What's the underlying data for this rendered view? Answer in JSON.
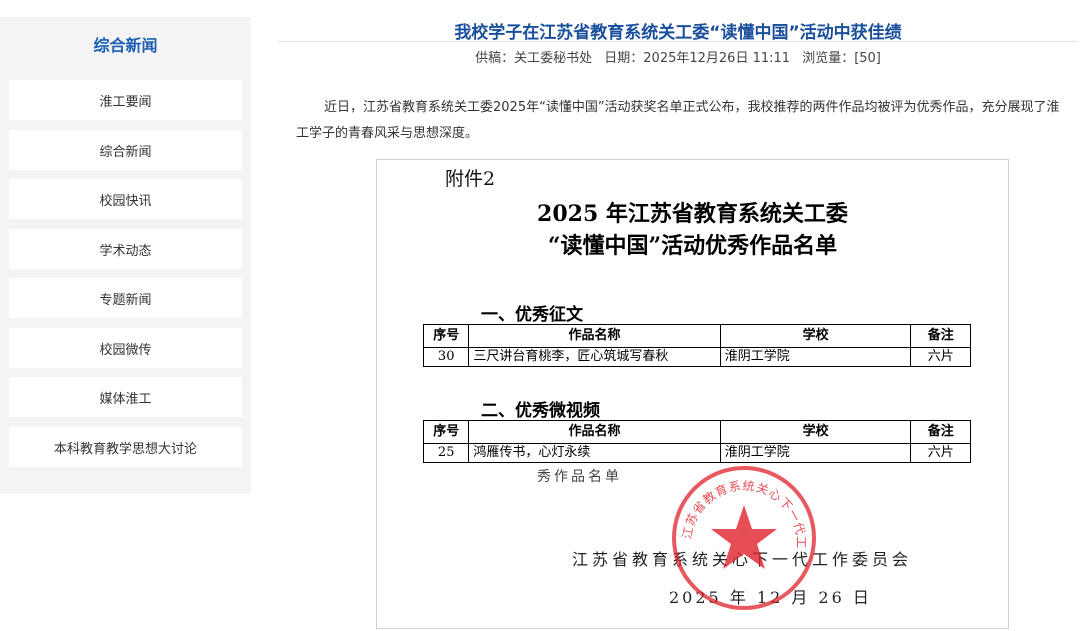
{
  "sidebar": {
    "title": "综合新闻",
    "items": [
      {
        "label": "淮工要闻"
      },
      {
        "label": "综合新闻"
      },
      {
        "label": "校园快讯"
      },
      {
        "label": "学术动态"
      },
      {
        "label": "专题新闻"
      },
      {
        "label": "校园微传"
      },
      {
        "label": "媒体淮工"
      },
      {
        "label": "本科教育教学思想大讨论"
      }
    ]
  },
  "article": {
    "title": "我校学子在江苏省教育系统关工委“读懂中国”活动中获佳绩",
    "meta": {
      "source": "供稿：关工委秘书处",
      "date": "日期：2025年12月26日 11:11",
      "views": "浏览量：[50]"
    },
    "body": "近日，江苏省教育系统关工委2025年“读懂中国”活动获奖名单正式公布，我校推荐的两件作品均被评为优秀作品，充分展现了淮工学子的青春风采与思想深度。"
  },
  "document": {
    "attachment": "附件2",
    "heading_line1": "2025 年江苏省教育系统关工委",
    "heading_line2": "“读懂中国”活动优秀作品名单",
    "section1": "一、优秀征文",
    "section2": "二、优秀微视频",
    "headers": {
      "no": "序号",
      "work": "作品名称",
      "school": "学校",
      "note": "备注"
    },
    "essay_rows": [
      {
        "no": "30",
        "work": "三尺讲台育桃李，匠心筑城写春秋",
        "school": "淮阴工学院",
        "note": "六片"
      }
    ],
    "video_rows": [
      {
        "no": "25",
        "work": "鸿雁传书，心灯永续",
        "school": "淮阴工学院",
        "note": "六片"
      }
    ],
    "handnote": "秀作品名单",
    "signature": "江苏省教育系统关心下一代工作委员会",
    "date": "2025 年 12 月 26 日",
    "seal_text": "江苏省教育系统关心下一代工作委员会",
    "seal_color": "#e0202a"
  }
}
